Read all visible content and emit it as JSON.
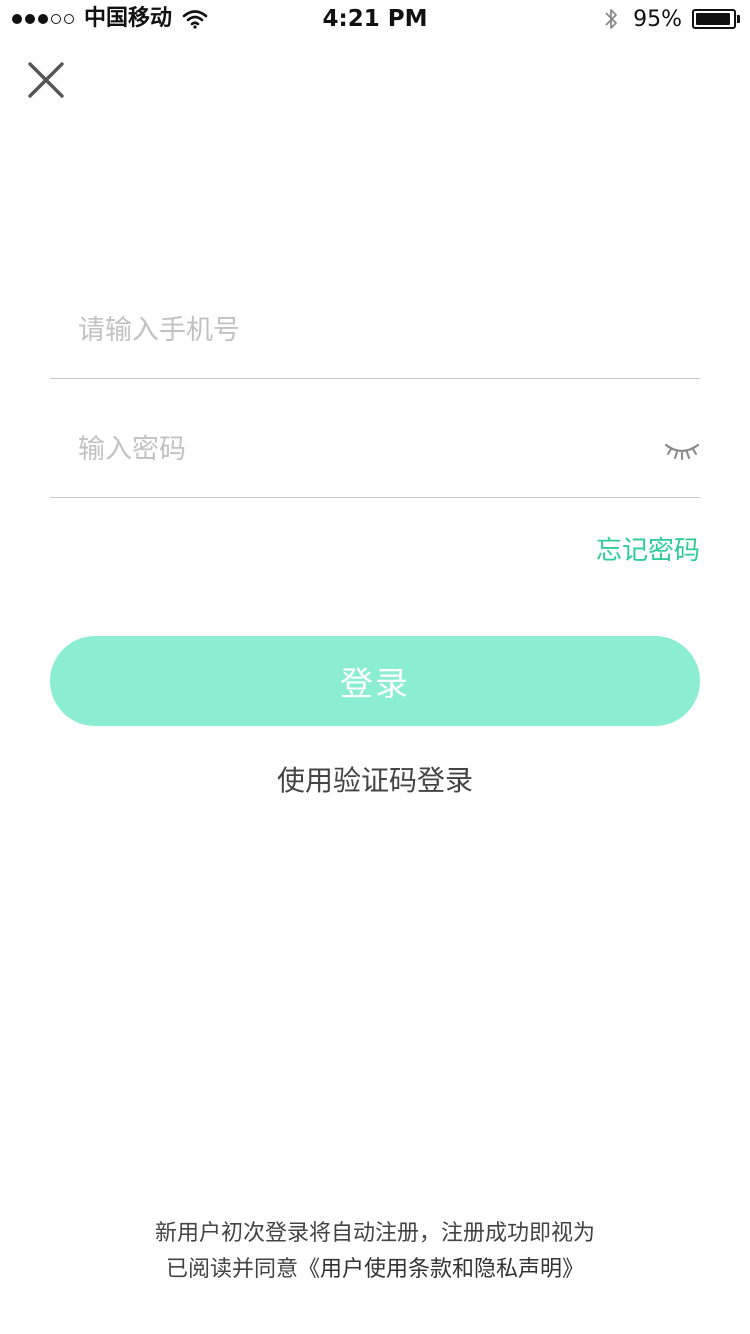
{
  "status_bar": {
    "carrier": "中国移动",
    "time": "4:21 PM",
    "battery_percent": "95%",
    "battery_level": 0.95,
    "signal_bars_filled": 3,
    "signal_bars_total": 5
  },
  "close_icon": "close-icon",
  "form": {
    "phone_placeholder": "请输入手机号",
    "phone_value": "",
    "password_placeholder": "输入密码",
    "password_value": "",
    "password_toggle_icon": "eye-closed-icon",
    "forgot_password": "忘记密码"
  },
  "login_button": "登录",
  "code_login": "使用验证码登录",
  "agreement": {
    "line1": "新用户初次登录将自动注册，注册成功即视为",
    "line2_prefix": "已阅读并同意",
    "link": "《用户使用条款和隐私声明》"
  },
  "colors": {
    "accent": "#2fcc9a",
    "button_bg": "#8beed2",
    "button_text": "#ffffff",
    "placeholder": "#c2c2c2",
    "divider": "#c8c8c8"
  }
}
